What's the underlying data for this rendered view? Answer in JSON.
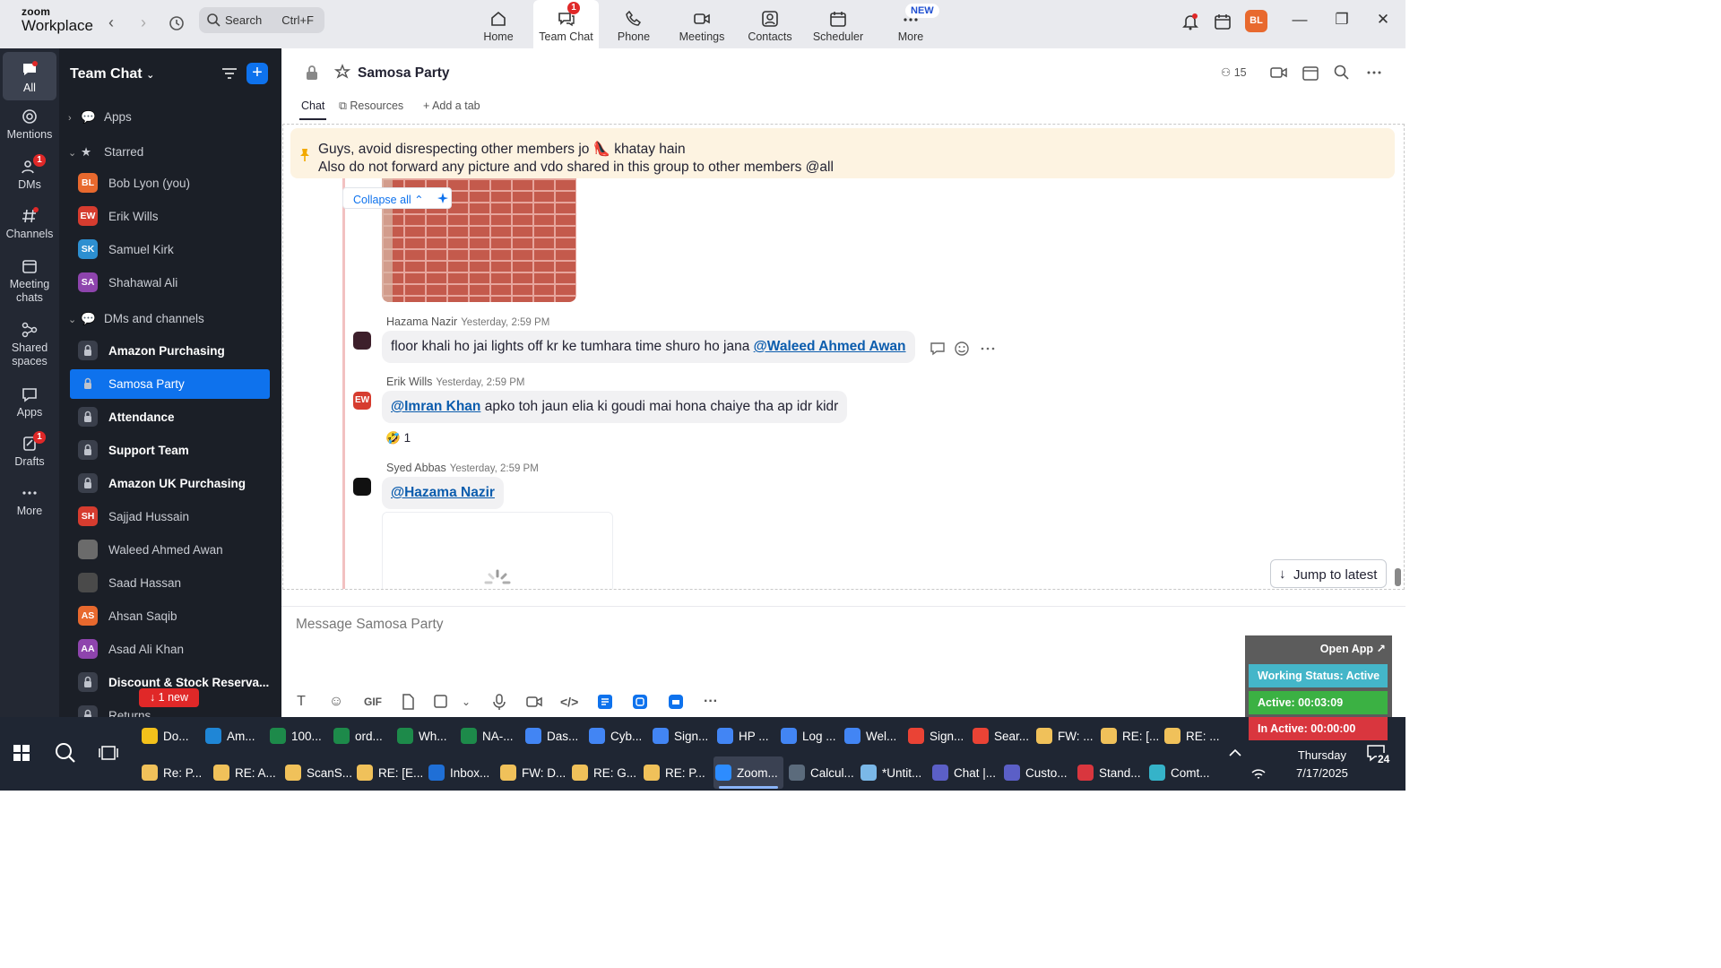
{
  "app": {
    "logo_line1": "zoom",
    "logo_line2": "Workplace"
  },
  "search": {
    "placeholder": "Search",
    "shortcut": "Ctrl+F"
  },
  "top_nav": [
    {
      "label": "Home",
      "icon": "home-icon"
    },
    {
      "label": "Team Chat",
      "icon": "chat-icon",
      "badge": "1"
    },
    {
      "label": "Phone",
      "icon": "phone-icon"
    },
    {
      "label": "Meetings",
      "icon": "video-icon"
    },
    {
      "label": "Contacts",
      "icon": "contacts-icon"
    },
    {
      "label": "Scheduler",
      "icon": "calendar-icon"
    },
    {
      "label": "More",
      "icon": "more-icon",
      "tag": "NEW"
    }
  ],
  "user": {
    "initials": "BL"
  },
  "rail": [
    {
      "label": "All",
      "active": true
    },
    {
      "label": "Mentions"
    },
    {
      "label": "DMs",
      "badge": "1"
    },
    {
      "label": "Channels"
    },
    {
      "label": "Meeting chats"
    },
    {
      "label": "Shared spaces"
    },
    {
      "label": "Apps"
    },
    {
      "label": "Drafts",
      "badge": "1"
    },
    {
      "label": "More"
    }
  ],
  "sidebar": {
    "title": "Team Chat",
    "sections": {
      "apps": "Apps",
      "starred": "Starred",
      "dms": "DMs and channels"
    },
    "starred": [
      {
        "initials": "BL",
        "name": "Bob Lyon (you)",
        "color": "#e8692e"
      },
      {
        "initials": "EW",
        "name": "Erik Wills",
        "color": "#d63c2f"
      },
      {
        "initials": "SK",
        "name": "Samuel Kirk",
        "color": "#2d8fd0"
      },
      {
        "initials": "SA",
        "name": "Shahawal Ali",
        "color": "#8e44ad"
      }
    ],
    "channels": [
      {
        "name": "Amazon Purchasing",
        "type": "lock",
        "bold": true
      },
      {
        "name": "Samosa Party",
        "type": "lock",
        "selected": true
      },
      {
        "name": "Attendance",
        "type": "lock",
        "bold": true
      },
      {
        "name": "Support Team",
        "type": "lock",
        "bold": true
      },
      {
        "name": "Amazon UK Purchasing",
        "type": "lock",
        "bold": true
      },
      {
        "name": "Sajjad Hussain",
        "type": "avatar",
        "initials": "SH",
        "color": "#d63c2f"
      },
      {
        "name": "Waleed Ahmed Awan",
        "type": "avatar",
        "initials": "",
        "color": "#6b6b6b"
      },
      {
        "name": "Saad Hassan",
        "type": "avatar",
        "initials": "",
        "color": "#4a4a4a"
      },
      {
        "name": "Ahsan Saqib",
        "type": "avatar",
        "initials": "AS",
        "color": "#e8692e"
      },
      {
        "name": "Asad Ali Khan",
        "type": "avatar",
        "initials": "AA",
        "color": "#8e44ad"
      },
      {
        "name": "Discount & Stock Reserva...",
        "type": "lock",
        "bold": true
      },
      {
        "name": "Returns",
        "type": "lock"
      }
    ],
    "new_pill": "↓ 1 new"
  },
  "channel": {
    "title": "Samosa Party",
    "member_count": "15",
    "tabs": [
      "Chat",
      "Resources",
      "Add a tab"
    ]
  },
  "pinned": {
    "line1": "Guys, avoid disrespecting other members jo 👠 khatay hain",
    "line2": "Also do not forward any picture and vdo shared in this group to other members @all"
  },
  "collapse_label": "Collapse all",
  "messages": [
    {
      "sender": "Hazama Nazir",
      "time": "Yesterday, 2:59 PM",
      "text": "floor khali ho jai lights off kr ke tumhara time shuro ho jana ",
      "mention": "@Waleed Ahmed Awan"
    },
    {
      "sender": "Erik Wills",
      "time": "Yesterday, 2:59 PM",
      "mention": "@Imran Khan",
      "text": " apko toh jaun elia ki goudi mai hona chaiye tha ap idr kidr",
      "avatar": "EW",
      "reaction": "🤣",
      "reaction_count": "1"
    },
    {
      "sender": "Syed Abbas",
      "time": "Yesterday, 2:59 PM",
      "mention": "@Hazama Nazir",
      "text": ""
    }
  ],
  "jump_label": "Jump to latest",
  "composer": {
    "placeholder": "Message Samosa Party",
    "gif": "GIF"
  },
  "widget": {
    "open": "Open App ↗",
    "status": "Working Status: Active",
    "active": "Active: 00:03:09",
    "inactive": "In Active: 00:00:00",
    "colors": {
      "status": "#44b6c9",
      "active": "#3bb143",
      "inactive": "#d9363e"
    }
  },
  "taskbar": {
    "row1": [
      {
        "label": "Do...",
        "color": "#f3c11b"
      },
      {
        "label": "Am...",
        "color": "#1f86d6"
      },
      {
        "label": "100...",
        "color": "#1d8a4a"
      },
      {
        "label": "ord...",
        "color": "#1d8a4a"
      },
      {
        "label": "Wh...",
        "color": "#1d8a4a"
      },
      {
        "label": "NA-...",
        "color": "#1d8a4a"
      },
      {
        "label": "Das...",
        "color": "#4285f4"
      },
      {
        "label": "Cyb...",
        "color": "#4285f4"
      },
      {
        "label": "Sign...",
        "color": "#4285f4"
      },
      {
        "label": "HP ...",
        "color": "#4285f4"
      },
      {
        "label": "Log ...",
        "color": "#4285f4"
      },
      {
        "label": "Wel...",
        "color": "#4285f4"
      },
      {
        "label": "Sign...",
        "color": "#ea4335"
      },
      {
        "label": "Sear...",
        "color": "#ea4335"
      },
      {
        "label": "FW: ...",
        "color": "#f0c15a"
      },
      {
        "label": "RE: [...",
        "color": "#f0c15a"
      },
      {
        "label": "RE: ...",
        "color": "#f0c15a"
      }
    ],
    "row2": [
      {
        "label": "Re: P...",
        "color": "#f0c15a"
      },
      {
        "label": "RE: A...",
        "color": "#f0c15a"
      },
      {
        "label": "ScanS...",
        "color": "#f0c15a"
      },
      {
        "label": "RE: [E...",
        "color": "#f0c15a"
      },
      {
        "label": "Inbox...",
        "color": "#1f6fd6"
      },
      {
        "label": "FW: D...",
        "color": "#f0c15a"
      },
      {
        "label": "RE: G...",
        "color": "#f0c15a"
      },
      {
        "label": "RE: P...",
        "color": "#f0c15a"
      },
      {
        "label": "Zoom...",
        "color": "#2d8cff",
        "active": true
      },
      {
        "label": "Calcul...",
        "color": "#5b6b7c"
      },
      {
        "label": "*Untit...",
        "color": "#7ab8e8"
      },
      {
        "label": "Chat |...",
        "color": "#5b5fc7"
      },
      {
        "label": "Custo...",
        "color": "#5b5fc7"
      },
      {
        "label": "Stand...",
        "color": "#d9363e"
      },
      {
        "label": "Comt...",
        "color": "#35b3c9"
      }
    ],
    "day": "Thursday",
    "date": "7/17/2025",
    "notif": "24"
  }
}
